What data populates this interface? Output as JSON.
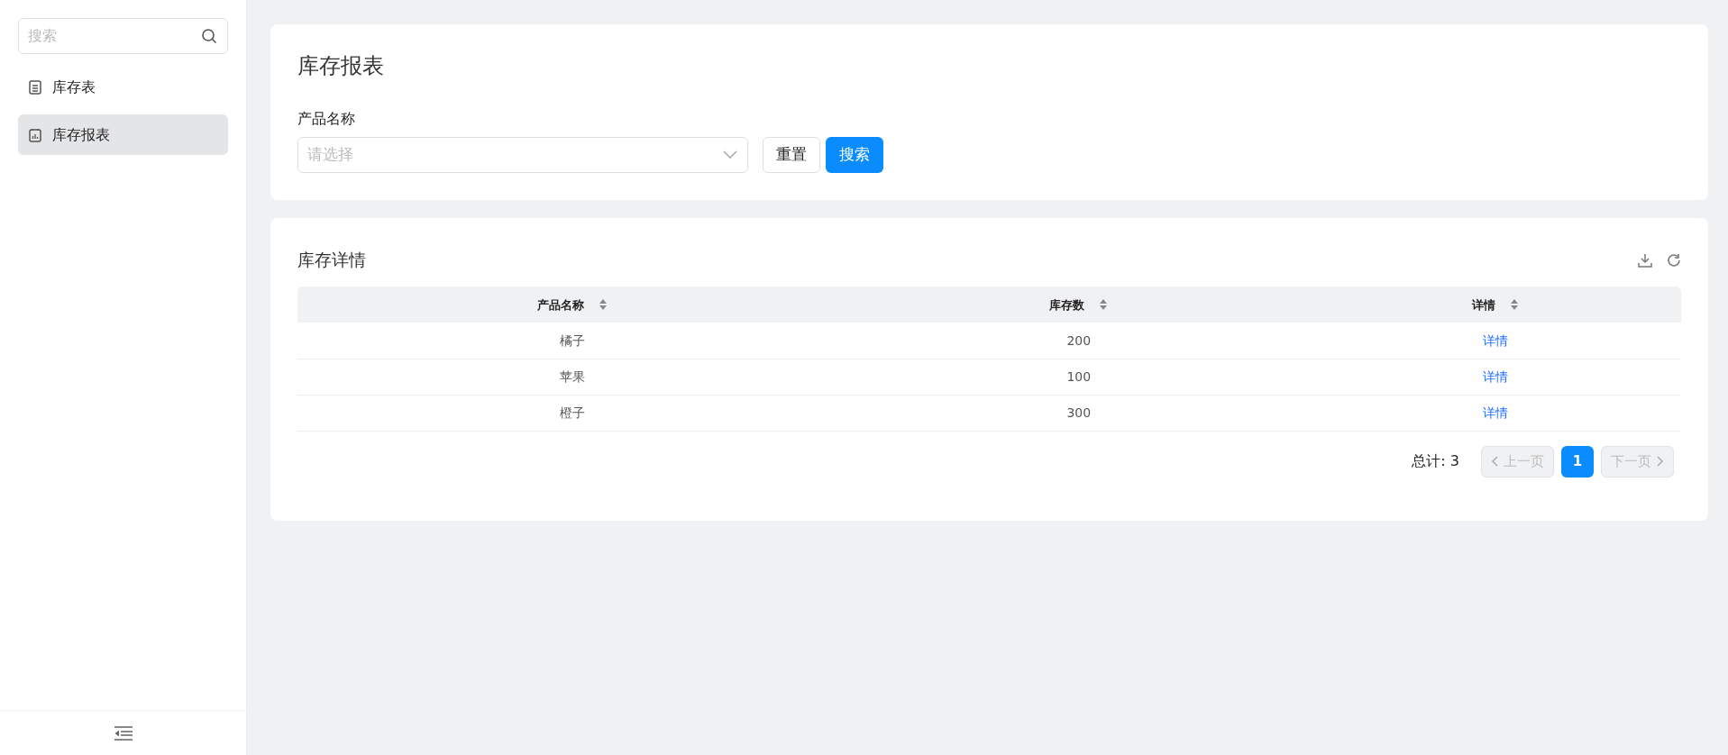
{
  "sidebar": {
    "search": {
      "placeholder": "搜索"
    },
    "items": [
      {
        "label": "库存表",
        "selected": false
      },
      {
        "label": "库存报表",
        "selected": true
      }
    ]
  },
  "filter_card": {
    "title": "库存报表",
    "field_label": "产品名称",
    "select": {
      "placeholder": "请选择"
    },
    "buttons": [
      {
        "label": "重置",
        "kind": "default"
      },
      {
        "label": "搜索",
        "kind": "primary"
      }
    ]
  },
  "table_card": {
    "title": "库存详情",
    "table": {
      "columns": [
        "产品名称",
        "库存数",
        "详情"
      ],
      "rows": [
        [
          "橘子",
          "200",
          "详情"
        ],
        [
          "苹果",
          "100",
          "详情"
        ],
        [
          "橙子",
          "300",
          "详情"
        ]
      ]
    },
    "pagination": {
      "total": "总计: 3",
      "prev": {
        "label": "上一页",
        "disabled": true
      },
      "pages": [
        {
          "label": "1",
          "selected": true
        }
      ],
      "next": {
        "label": "下一页",
        "disabled": true
      }
    }
  }
}
